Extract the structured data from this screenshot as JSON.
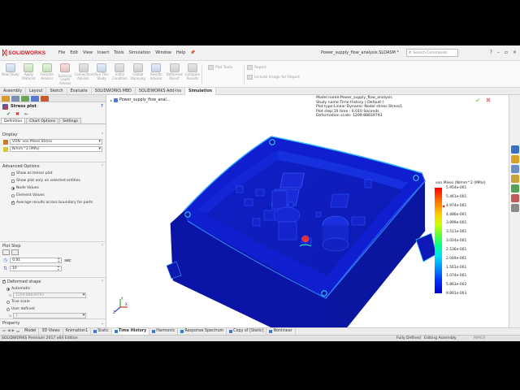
{
  "app": {
    "brand": "SOLIDWORKS",
    "document_title": "Power_supply_flow_analysis.SLDASM *"
  },
  "menu": [
    "File",
    "Edit",
    "View",
    "Insert",
    "Tools",
    "Simulation",
    "Window",
    "Help"
  ],
  "search": {
    "placeholder": "Search Commands"
  },
  "ribbon": {
    "buttons": [
      {
        "label": "New Study",
        "icon": "new-study-icon",
        "tone": "bl"
      },
      {
        "label": "Apply Material",
        "icon": "apply-material-icon",
        "tone": "gr"
      },
      {
        "label": "Fixtures Advisor",
        "icon": "fixtures-advisor-icon",
        "tone": "gr"
      },
      {
        "label": "External Loads Advisor",
        "icon": "external-loads-icon",
        "tone": "rd"
      },
      {
        "label": "Connections Advisor",
        "icon": "connections-advisor-icon",
        "tone": ""
      },
      {
        "label": "Run This Study",
        "icon": "run-study-icon",
        "tone": "bl"
      },
      {
        "label": "Initial Condition",
        "icon": "initial-condition-icon",
        "tone": ""
      },
      {
        "label": "Global Damping",
        "icon": "global-damping-icon",
        "tone": ""
      },
      {
        "label": "Results Advisor",
        "icon": "results-advisor-icon",
        "tone": "bl"
      },
      {
        "label": "Deformed Result",
        "icon": "deformed-result-icon",
        "tone": ""
      },
      {
        "label": "Compare Results",
        "icon": "compare-results-icon",
        "tone": ""
      }
    ],
    "plot_tools": "Plot Tools",
    "report": "Report",
    "include_image": "Include Image for Report"
  },
  "command_tabs": [
    {
      "label": "Assembly",
      "active": false
    },
    {
      "label": "Layout",
      "active": false
    },
    {
      "label": "Sketch",
      "active": false
    },
    {
      "label": "Evaluate",
      "active": false
    },
    {
      "label": "SOLIDWORKS MBD",
      "active": false
    },
    {
      "label": "SOLIDWORKS Add-Ins",
      "active": false
    },
    {
      "label": "Simulation",
      "active": true
    }
  ],
  "property_manager": {
    "title": "Stress plot",
    "subtabs": [
      "Definition",
      "Chart Options",
      "Settings"
    ],
    "display": {
      "header": "Display",
      "component": "VON: von Mises Stress",
      "units": "N/mm^2 (MPa)"
    },
    "advanced": {
      "header": "Advanced Options",
      "options": [
        {
          "label": "Show as tensor plot",
          "kind": "checkbox",
          "checked": false
        },
        {
          "label": "Show plot only on selected entities",
          "kind": "checkbox",
          "checked": false
        },
        {
          "label": "Node Values",
          "kind": "radio",
          "checked": true
        },
        {
          "label": "Element Values",
          "kind": "radio",
          "checked": false
        },
        {
          "label": "Average results across boundary for parts",
          "kind": "checkbox",
          "checked": true
        }
      ]
    },
    "plot_step": {
      "header": "Plot Step",
      "time_value": "0.01",
      "time_unit": "sec",
      "step_value": "10"
    },
    "deformed": {
      "header": "Deformed shape",
      "checked": true,
      "options": [
        {
          "label": "Automatic",
          "checked": true
        },
        {
          "label": "True scale",
          "checked": false
        },
        {
          "label": "User defined",
          "checked": false
        }
      ],
      "auto_value": "1209.88839793",
      "user_value": "1"
    },
    "property_header": "Property"
  },
  "graphics": {
    "feature_tree_item": "Power_supply_flow_anal...",
    "info_lines": [
      "Model name:Power_supply_flow_analysis",
      "Study name:Time History (-Default-)",
      "Plot type:Linear Dynamic Nodal stress Stress1",
      "Plot step:10   time : 0.010 Seconds",
      "Deformation scale: 1209.88839793"
    ],
    "legend_title": "von Mises (N/mm^2 (MPa))",
    "legend_values": [
      "5.954e-001",
      "5.461e-001",
      "4.974e-001",
      "4.486e-001",
      "3.999e-001",
      "3.511e-001",
      "3.024e-001",
      "2.536e-001",
      "2.049e-001",
      "1.561e-001",
      "1.074e-001",
      "5.863e-002",
      "9.891e-003"
    ],
    "triad_labels": {
      "x": "X",
      "y": "Y",
      "z": "Z"
    }
  },
  "bottom_tabs": [
    {
      "label": "Model",
      "active": false,
      "color": ""
    },
    {
      "label": "3D Views",
      "active": false,
      "color": ""
    },
    {
      "label": "Animation1",
      "active": false,
      "color": ""
    },
    {
      "label": "Static",
      "active": false,
      "color": "#3a7bd5"
    },
    {
      "label": "Time History",
      "active": true,
      "color": "#3a7bd5"
    },
    {
      "label": "Harmonic",
      "active": false,
      "color": "#3a7bd5"
    },
    {
      "label": "Response Spectrum",
      "active": false,
      "color": "#3a7bd5"
    },
    {
      "label": "Copy of [Static]",
      "active": false,
      "color": "#3a7bd5"
    },
    {
      "label": "Nonlinear",
      "active": false,
      "color": "#3a7bd5"
    }
  ],
  "status": {
    "edition": "SOLIDWORKS Premium 2017 x64 Edition",
    "definition": "Fully Defined",
    "editing": "Editing Assembly",
    "units": "MMGS"
  },
  "colors": {
    "accent_red": "#d0121b",
    "legend_max": "#ff0000",
    "legend_min": "#0000d0"
  }
}
